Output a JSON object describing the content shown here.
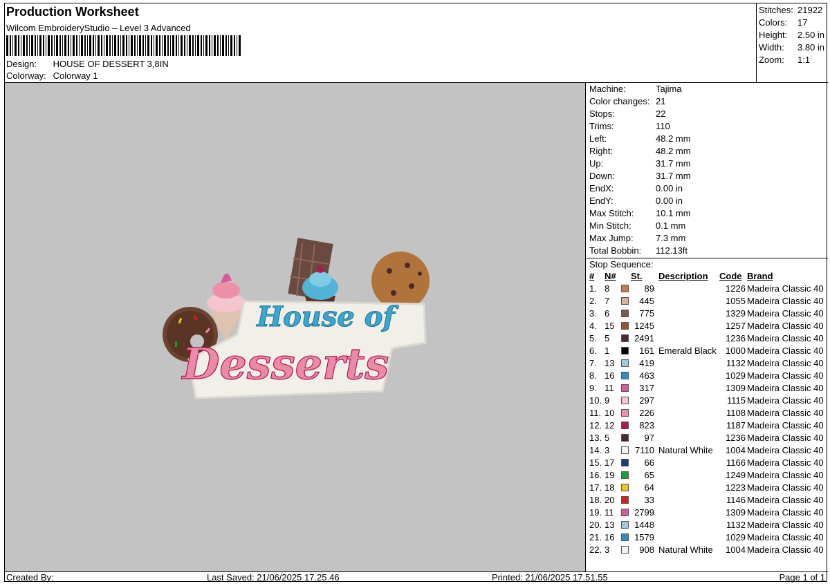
{
  "header": {
    "title": "Production Worksheet",
    "software": "Wilcom EmbroideryStudio – Level 3 Advanced",
    "design_label": "Design:",
    "design_value": "HOUSE OF DESSERT 3,8IN",
    "colorway_label": "Colorway:",
    "colorway_value": "Colorway 1"
  },
  "stats": [
    {
      "label": "Stitches:",
      "value": "21922"
    },
    {
      "label": "Colors:",
      "value": "17"
    },
    {
      "label": "Height:",
      "value": "2.50 in"
    },
    {
      "label": "Width:",
      "value": "3.80 in"
    },
    {
      "label": "Zoom:",
      "value": "1:1"
    }
  ],
  "machine_info": [
    {
      "label": "Machine:",
      "value": "Tajima"
    },
    {
      "label": "Color changes:",
      "value": "21"
    },
    {
      "label": "Stops:",
      "value": "22"
    },
    {
      "label": "Trims:",
      "value": "110"
    },
    {
      "label": "Left:",
      "value": "48.2 mm"
    },
    {
      "label": "Right:",
      "value": "48.2 mm"
    },
    {
      "label": "Up:",
      "value": "31.7 mm"
    },
    {
      "label": "Down:",
      "value": "31.7 mm"
    },
    {
      "label": "EndX:",
      "value": "0.00 in"
    },
    {
      "label": "EndY:",
      "value": "0.00 in"
    },
    {
      "label": "Max Stitch:",
      "value": "10.1 mm"
    },
    {
      "label": "Min Stitch:",
      "value": "0.1 mm"
    },
    {
      "label": "Max Jump:",
      "value": "7.3 mm"
    },
    {
      "label": "Total Bobbin:",
      "value": "112.13ft"
    }
  ],
  "stop_sequence": {
    "title": "Stop Sequence:",
    "headers": {
      "idx": "#",
      "n": "N#",
      "st": "St.",
      "desc": "Description",
      "code": "Code",
      "brand": "Brand"
    },
    "rows": [
      {
        "idx": "1.",
        "n": "8",
        "color": "#c97b4d",
        "st": "89",
        "desc": "",
        "code": "1226",
        "brand": "Madeira Classic 40"
      },
      {
        "idx": "2.",
        "n": "7",
        "color": "#d8b39a",
        "st": "445",
        "desc": "",
        "code": "1055",
        "brand": "Madeira Classic 40"
      },
      {
        "idx": "3.",
        "n": "6",
        "color": "#7a5a4a",
        "st": "775",
        "desc": "",
        "code": "1329",
        "brand": "Madeira Classic 40"
      },
      {
        "idx": "4.",
        "n": "15",
        "color": "#9a5530",
        "st": "1245",
        "desc": "",
        "code": "1257",
        "brand": "Madeira Classic 40"
      },
      {
        "idx": "5.",
        "n": "5",
        "color": "#4a2a2e",
        "st": "2491",
        "desc": "",
        "code": "1236",
        "brand": "Madeira Classic 40"
      },
      {
        "idx": "6.",
        "n": "1",
        "color": "#000000",
        "st": "161",
        "desc": "Emerald Black",
        "code": "1000",
        "brand": "Madeira Classic 40"
      },
      {
        "idx": "7.",
        "n": "13",
        "color": "#9ec9e2",
        "st": "419",
        "desc": "",
        "code": "1132",
        "brand": "Madeira Classic 40"
      },
      {
        "idx": "8.",
        "n": "16",
        "color": "#2f8cc7",
        "st": "463",
        "desc": "",
        "code": "1029",
        "brand": "Madeira Classic 40"
      },
      {
        "idx": "9.",
        "n": "11",
        "color": "#d95b9a",
        "st": "317",
        "desc": "",
        "code": "1309",
        "brand": "Madeira Classic 40"
      },
      {
        "idx": "10.",
        "n": "9",
        "color": "#f4c4cf",
        "st": "297",
        "desc": "",
        "code": "1115",
        "brand": "Madeira Classic 40"
      },
      {
        "idx": "11.",
        "n": "10",
        "color": "#ee8fa8",
        "st": "226",
        "desc": "",
        "code": "1108",
        "brand": "Madeira Classic 40"
      },
      {
        "idx": "12.",
        "n": "12",
        "color": "#b3154f",
        "st": "823",
        "desc": "",
        "code": "1187",
        "brand": "Madeira Classic 40"
      },
      {
        "idx": "13.",
        "n": "5",
        "color": "#4a2a2e",
        "st": "97",
        "desc": "",
        "code": "1236",
        "brand": "Madeira Classic 40"
      },
      {
        "idx": "14.",
        "n": "3",
        "color": "#f4f4f0",
        "st": "7110",
        "desc": "Natural White",
        "code": "1004",
        "brand": "Madeira Classic 40"
      },
      {
        "idx": "15.",
        "n": "17",
        "color": "#1f3a7a",
        "st": "66",
        "desc": "",
        "code": "1166",
        "brand": "Madeira Classic 40"
      },
      {
        "idx": "16.",
        "n": "19",
        "color": "#17a13a",
        "st": "65",
        "desc": "",
        "code": "1249",
        "brand": "Madeira Classic 40"
      },
      {
        "idx": "17.",
        "n": "18",
        "color": "#f2c21a",
        "st": "64",
        "desc": "",
        "code": "1223",
        "brand": "Madeira Classic 40"
      },
      {
        "idx": "18.",
        "n": "20",
        "color": "#d42020",
        "st": "33",
        "desc": "",
        "code": "1146",
        "brand": "Madeira Classic 40"
      },
      {
        "idx": "19.",
        "n": "11",
        "color": "#d95b9a",
        "st": "2799",
        "desc": "",
        "code": "1309",
        "brand": "Madeira Classic 40"
      },
      {
        "idx": "20.",
        "n": "13",
        "color": "#9ec9e2",
        "st": "1448",
        "desc": "",
        "code": "1132",
        "brand": "Madeira Classic 40"
      },
      {
        "idx": "21.",
        "n": "16",
        "color": "#2f8cc7",
        "st": "1579",
        "desc": "",
        "code": "1029",
        "brand": "Madeira Classic 40"
      },
      {
        "idx": "22.",
        "n": "3",
        "color": "#f4f4f0",
        "st": "908",
        "desc": "Natural White",
        "code": "1004",
        "brand": "Madeira Classic 40"
      }
    ]
  },
  "artwork": {
    "line1": "House of",
    "line2": "Desserts"
  },
  "footer": {
    "created_by": "Created By:",
    "last_saved": "Last Saved: 21/06/2025 17.25.46",
    "printed": "Printed: 21/06/2025 17.51.55",
    "page": "Page 1 of 1"
  },
  "colors": {
    "preview_bg": "#c3c3c3",
    "pink": "#e88aa8",
    "blue": "#3aa7cf",
    "patch_white": "#f0efe8"
  }
}
